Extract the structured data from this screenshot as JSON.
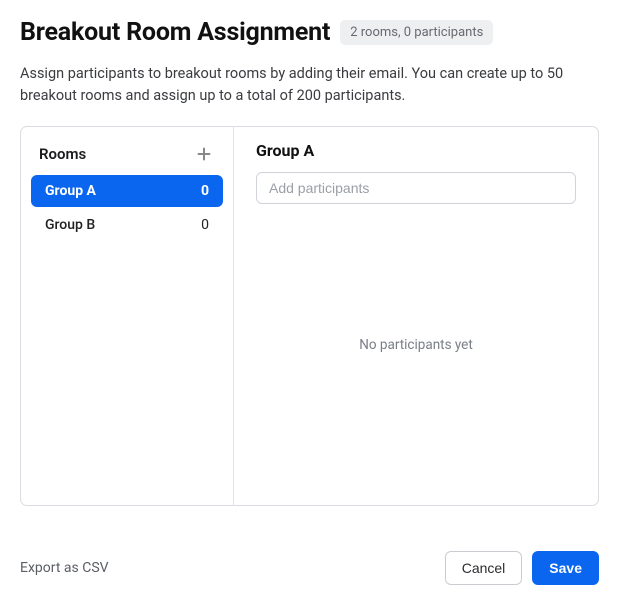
{
  "header": {
    "title": "Breakout Room Assignment",
    "summary": "2 rooms, 0 participants"
  },
  "description": "Assign participants to breakout rooms by adding their email. You can create up to 50 breakout rooms and assign up to a total of 200 participants.",
  "rooms_panel": {
    "heading": "Rooms",
    "items": [
      {
        "name": "Group A",
        "count": "0",
        "selected": true
      },
      {
        "name": "Group B",
        "count": "0",
        "selected": false
      }
    ]
  },
  "detail_panel": {
    "heading": "Group A",
    "input_placeholder": "Add participants",
    "empty_text": "No participants yet"
  },
  "footer": {
    "export_label": "Export as CSV",
    "cancel_label": "Cancel",
    "save_label": "Save"
  }
}
